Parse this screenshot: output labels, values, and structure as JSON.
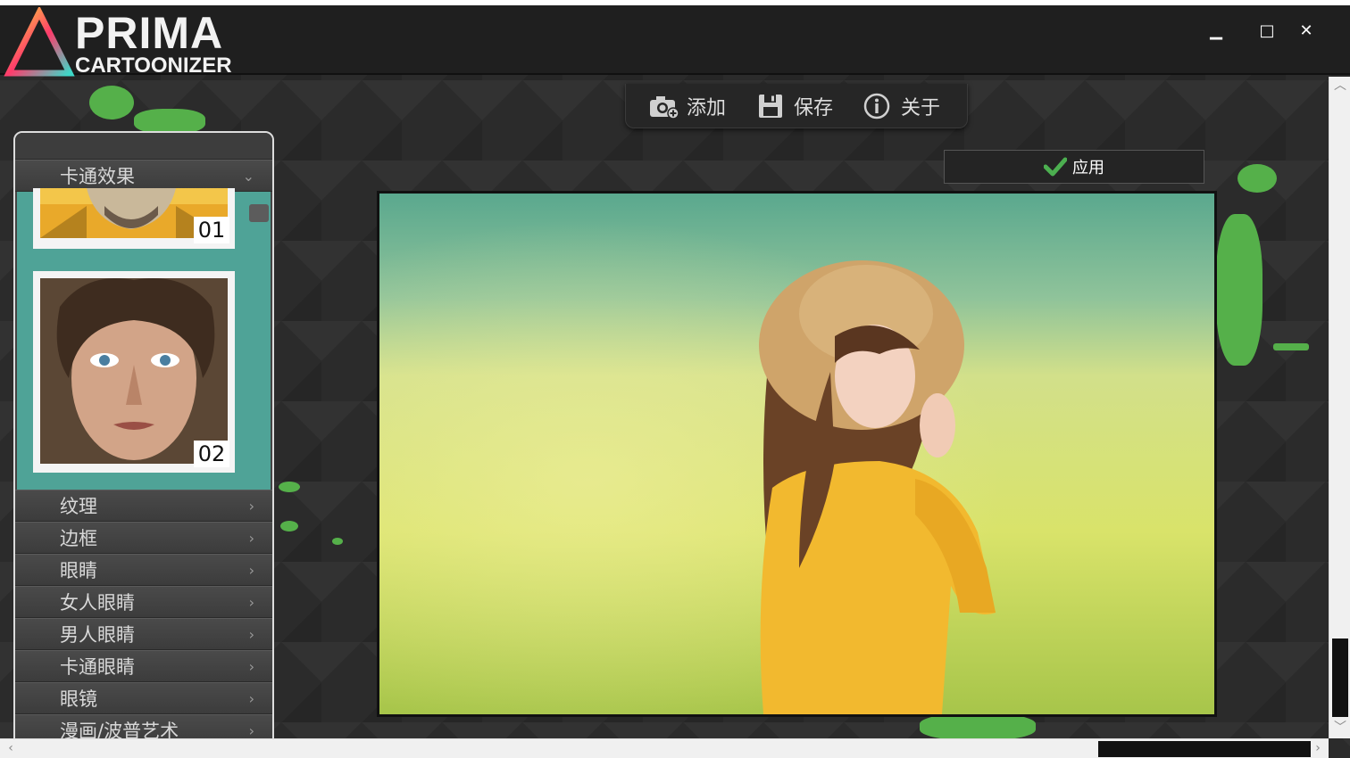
{
  "app": {
    "logo_word": "PRIMA",
    "logo_sub": "CARTOONIZER"
  },
  "window": {
    "minimize": "▁",
    "maximize": "□",
    "close": "✕"
  },
  "toolbar": {
    "add_label": "添加",
    "save_label": "保存",
    "about_label": "关于",
    "add_icon": "camera-add-icon",
    "save_icon": "floppy-disk-icon",
    "about_icon": "info-icon"
  },
  "apply": {
    "label": "应用",
    "icon": "checkmark-icon"
  },
  "sidebar": {
    "expanded_category": "卡通效果",
    "effects": [
      {
        "number": "01"
      },
      {
        "number": "02"
      }
    ],
    "categories": [
      "纹理",
      "边框",
      "眼睛",
      "女人眼睛",
      "男人眼睛",
      "卡通眼睛",
      "眼镜",
      "漫画/波普艺术"
    ]
  },
  "colors": {
    "accent_teal": "#4fa397",
    "apply_check": "#4caf50",
    "brand_green": "#55b04a"
  }
}
